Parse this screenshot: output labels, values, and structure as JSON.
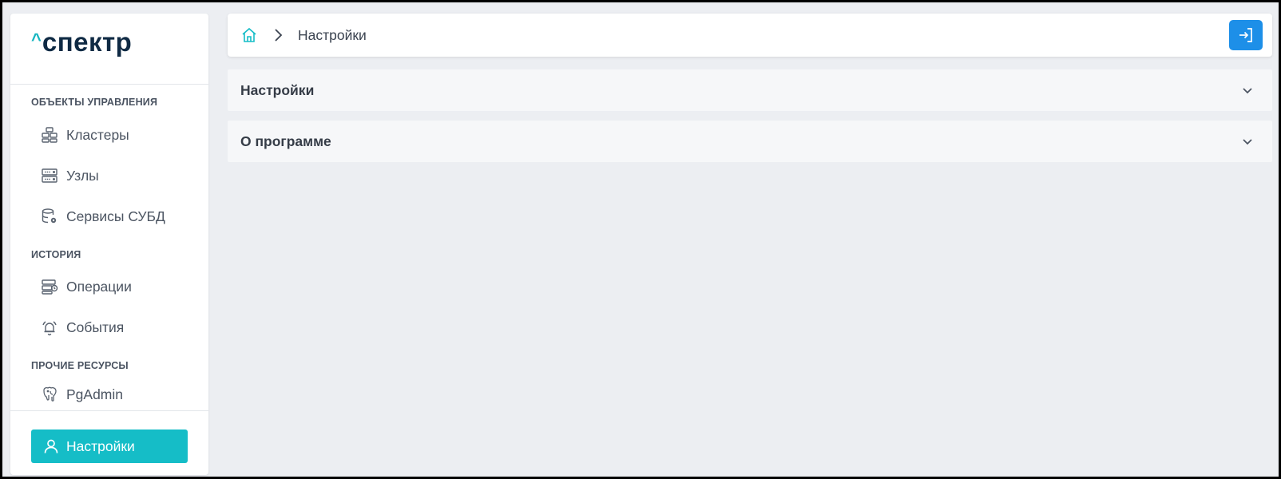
{
  "app": {
    "logo_caret": "^",
    "logo_text": "спектр"
  },
  "sidebar": {
    "sections": [
      {
        "title": "ОБЪЕКТЫ УПРАВЛЕНИЯ"
      },
      {
        "title": "ИСТОРИЯ"
      },
      {
        "title": "ПРОЧИЕ РЕСУРСЫ"
      }
    ],
    "items": [
      {
        "label": "Кластеры",
        "icon": "cluster-icon"
      },
      {
        "label": "Узлы",
        "icon": "server-icon"
      },
      {
        "label": "Сервисы СУБД",
        "icon": "database-settings-icon"
      },
      {
        "label": "Операции",
        "icon": "operations-icon"
      },
      {
        "label": "События",
        "icon": "alarm-bell-icon"
      },
      {
        "label": "PgAdmin",
        "icon": "postgres-elephant-icon"
      }
    ],
    "settings_label": "Настройки",
    "settings_icon": "user-icon"
  },
  "topbar": {
    "home_icon": "home-icon",
    "separator_icon": "chevron-right-icon",
    "breadcrumb_current": "Настройки",
    "logout_icon": "logout-icon"
  },
  "panels": [
    {
      "title": "Настройки",
      "icon": "chevron-down-icon"
    },
    {
      "title": "О программе",
      "icon": "chevron-down-icon"
    }
  ],
  "colors": {
    "accent": "#15bdc7",
    "primary_button": "#1d8fe8",
    "logo_dark": "#0f2a44",
    "background": "#eceef2"
  }
}
